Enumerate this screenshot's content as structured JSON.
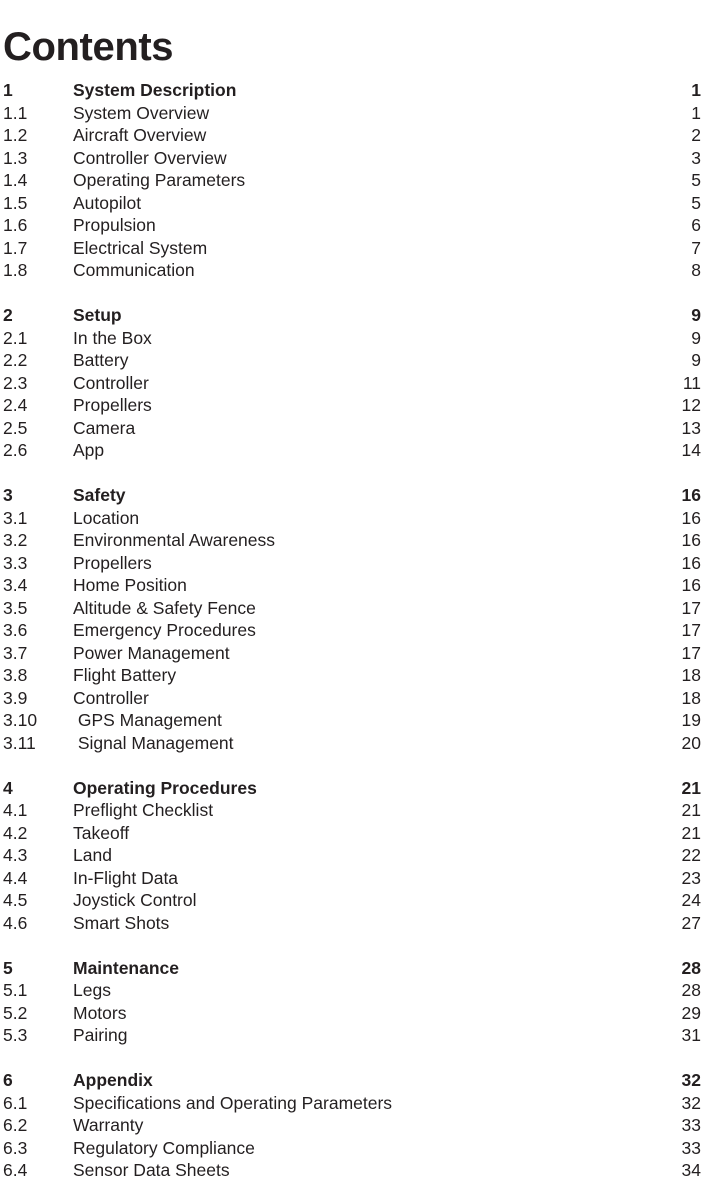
{
  "document": {
    "title": "Contents"
  },
  "toc": {
    "groups": [
      {
        "entries": [
          {
            "number": "1",
            "label": "System Description",
            "page": "1",
            "level": "section"
          },
          {
            "number": "1.1",
            "label": "System Overview",
            "page": "1",
            "level": "sub"
          },
          {
            "number": "1.2",
            "label": "Aircraft Overview",
            "page": "2",
            "level": "sub"
          },
          {
            "number": "1.3",
            "label": "Controller Overview",
            "page": "3",
            "level": "sub"
          },
          {
            "number": "1.4",
            "label": "Operating Parameters",
            "page": "5",
            "level": "sub"
          },
          {
            "number": "1.5",
            "label": "Autopilot",
            "page": "5",
            "level": "sub"
          },
          {
            "number": "1.6",
            "label": "Propulsion",
            "page": "6",
            "level": "sub"
          },
          {
            "number": "1.7",
            "label": "Electrical System",
            "page": "7",
            "level": "sub"
          },
          {
            "number": "1.8",
            "label": "Communication",
            "page": "8",
            "level": "sub"
          }
        ]
      },
      {
        "entries": [
          {
            "number": "2",
            "label": "Setup",
            "page": "9",
            "level": "section"
          },
          {
            "number": "2.1",
            "label": "In the Box",
            "page": "9",
            "level": "sub"
          },
          {
            "number": "2.2",
            "label": "Battery",
            "page": "9",
            "level": "sub"
          },
          {
            "number": "2.3",
            "label": "Controller",
            "page": "11",
            "level": "sub"
          },
          {
            "number": "2.4",
            "label": "Propellers",
            "page": "12",
            "level": "sub"
          },
          {
            "number": "2.5",
            "label": "Camera",
            "page": "13",
            "level": "sub"
          },
          {
            "number": "2.6",
            "label": "App",
            "page": "14",
            "level": "sub"
          }
        ]
      },
      {
        "entries": [
          {
            "number": "3",
            "label": "Safety",
            "page": "16",
            "level": "section"
          },
          {
            "number": "3.1",
            "label": "Location",
            "page": "16",
            "level": "sub"
          },
          {
            "number": "3.2",
            "label": "Environmental Awareness",
            "page": "16",
            "level": "sub"
          },
          {
            "number": "3.3",
            "label": "Propellers",
            "page": "16",
            "level": "sub"
          },
          {
            "number": "3.4",
            "label": "Home Position",
            "page": "16",
            "level": "sub"
          },
          {
            "number": "3.5",
            "label": "Altitude & Safety Fence",
            "page": "17",
            "level": "sub"
          },
          {
            "number": "3.6",
            "label": "Emergency Procedures",
            "page": "17",
            "level": "sub"
          },
          {
            "number": "3.7",
            "label": "Power Management",
            "page": "17",
            "level": "sub"
          },
          {
            "number": "3.8",
            "label": "Flight Battery",
            "page": "18",
            "level": "sub"
          },
          {
            "number": "3.9",
            "label": "Controller",
            "page": "18",
            "level": "sub"
          },
          {
            "number": "3.10",
            "label": " GPS Management",
            "page": "19",
            "level": "sub"
          },
          {
            "number": "3.11",
            "label": " Signal Management",
            "page": "20",
            "level": "sub"
          }
        ]
      },
      {
        "entries": [
          {
            "number": "4",
            "label": "Operating Procedures",
            "page": "21",
            "level": "section"
          },
          {
            "number": "4.1",
            "label": "Preflight Checklist",
            "page": "21",
            "level": "sub"
          },
          {
            "number": "4.2",
            "label": "Takeoff",
            "page": "21",
            "level": "sub"
          },
          {
            "number": "4.3",
            "label": "Land",
            "page": "22",
            "level": "sub"
          },
          {
            "number": "4.4",
            "label": "In-Flight Data",
            "page": "23",
            "level": "sub"
          },
          {
            "number": "4.5",
            "label": "Joystick Control",
            "page": "24",
            "level": "sub"
          },
          {
            "number": "4.6",
            "label": "Smart Shots",
            "page": "27",
            "level": "sub"
          }
        ]
      },
      {
        "entries": [
          {
            "number": "5",
            "label": "Maintenance",
            "page": "28",
            "level": "section"
          },
          {
            "number": "5.1",
            "label": "Legs",
            "page": "28",
            "level": "sub"
          },
          {
            "number": "5.2",
            "label": "Motors",
            "page": "29",
            "level": "sub"
          },
          {
            "number": "5.3",
            "label": "Pairing",
            "page": "31",
            "level": "sub"
          }
        ]
      },
      {
        "entries": [
          {
            "number": "6",
            "label": "Appendix",
            "page": "32",
            "level": "section"
          },
          {
            "number": "6.1",
            "label": "Specifications and Operating Parameters",
            "page": "32",
            "level": "sub"
          },
          {
            "number": "6.2",
            "label": "Warranty",
            "page": "33",
            "level": "sub"
          },
          {
            "number": "6.3",
            "label": "Regulatory Compliance",
            "page": "33",
            "level": "sub"
          },
          {
            "number": "6.4",
            "label": "Sensor Data Sheets",
            "page": "34",
            "level": "sub"
          }
        ]
      }
    ]
  },
  "style": {
    "text_color": "#231f20",
    "background_color": "#ffffff"
  }
}
